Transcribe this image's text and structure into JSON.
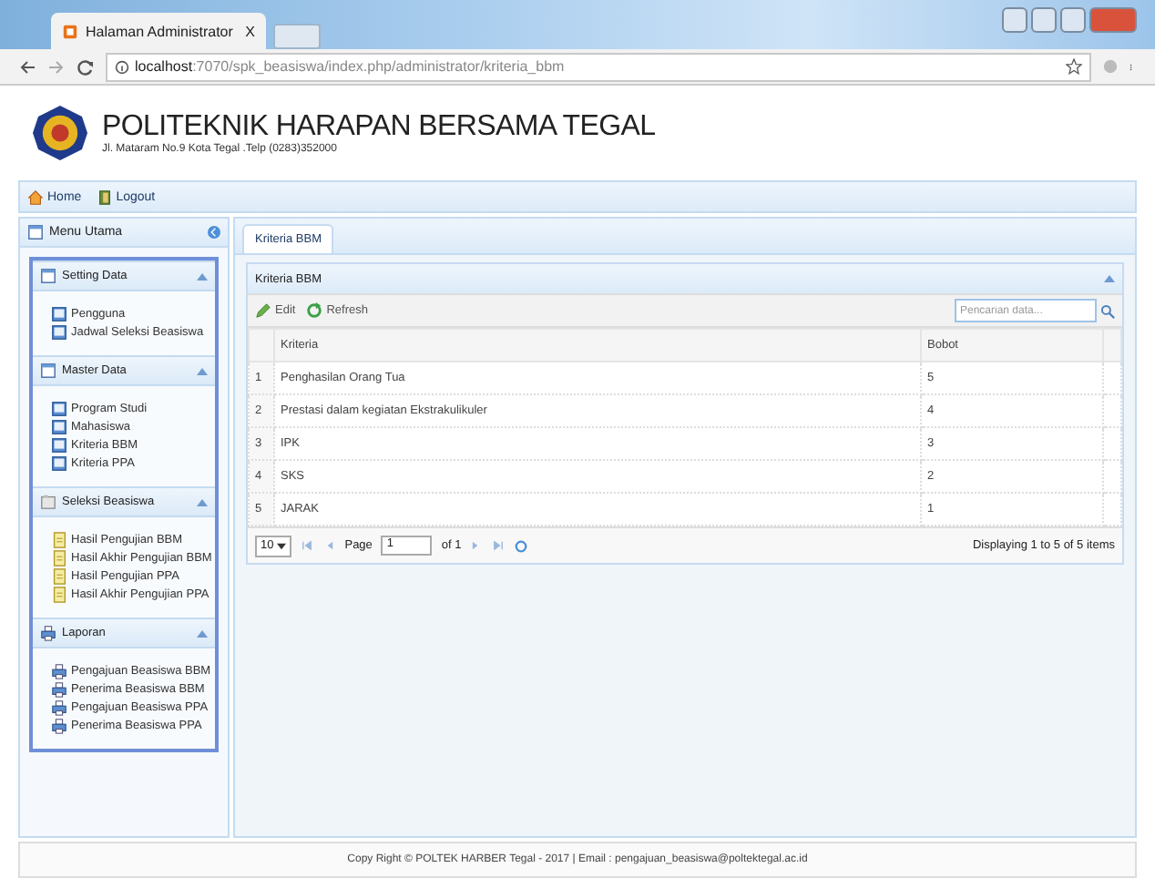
{
  "browser": {
    "tab_title": "Halaman Administrator",
    "tab_close": "X",
    "address_host": "localhost",
    "address_path": ":7070/spk_beasiswa/index.php/administrator/kriteria_bbm"
  },
  "header": {
    "title": "POLITEKNIK HARAPAN BERSAMA TEGAL",
    "subtitle": "Jl. Mataram No.9 Kota Tegal .Telp (0283)352000"
  },
  "nav": [
    {
      "label": "Home",
      "kind": "home"
    },
    {
      "label": "Logout",
      "kind": "logout"
    }
  ],
  "sidebar": {
    "title": "Menu Utama",
    "sections": [
      {
        "title": "Setting Data",
        "kind": "form",
        "expanded": true,
        "items": [
          {
            "label": "Pengguna",
            "kind": "book"
          },
          {
            "label": "Jadwal Seleksi Beasiswa",
            "kind": "book"
          }
        ]
      },
      {
        "title": "Master Data",
        "kind": "form",
        "expanded": true,
        "items": [
          {
            "label": "Program Studi",
            "kind": "book"
          },
          {
            "label": "Mahasiswa",
            "kind": "book"
          },
          {
            "label": "Kriteria BBM",
            "kind": "book"
          },
          {
            "label": "Kriteria PPA",
            "kind": "book"
          }
        ]
      },
      {
        "title": "Seleksi Beasiswa",
        "kind": "folder",
        "expanded": true,
        "items": [
          {
            "label": "Hasil Pengujian BBM",
            "kind": "document"
          },
          {
            "label": "Hasil Akhir Pengujian BBM",
            "kind": "document"
          },
          {
            "label": "Hasil Pengujian PPA",
            "kind": "document"
          },
          {
            "label": "Hasil Akhir Pengujian PPA",
            "kind": "document"
          }
        ]
      },
      {
        "title": "Laporan",
        "kind": "printer",
        "expanded": true,
        "items": [
          {
            "label": "Pengajuan Beasiswa BBM",
            "kind": "printer"
          },
          {
            "label": "Penerima Beasiswa BBM",
            "kind": "printer"
          },
          {
            "label": "Pengajuan Beasiswa PPA",
            "kind": "printer"
          },
          {
            "label": "Penerima Beasiswa PPA",
            "kind": "printer"
          }
        ]
      }
    ]
  },
  "tabs": [
    {
      "label": "Kriteria BBM",
      "selected": true
    }
  ],
  "panel": {
    "title": "Kriteria BBM",
    "actions": [
      {
        "label": "Edit",
        "kind": "edit"
      },
      {
        "label": "Refresh",
        "kind": "refresh"
      }
    ],
    "search": {
      "placeholder": "Pencarian data..."
    },
    "table": {
      "columns": [
        "Kriteria",
        "Bobot"
      ],
      "rows": [
        {
          "number": "1",
          "kriteria": "Penghasilan Orang Tua",
          "bobot": "5"
        },
        {
          "number": "2",
          "kriteria": "Prestasi dalam kegiatan Ekstrakulikuler",
          "bobot": "4"
        },
        {
          "number": "3",
          "kriteria": "IPK",
          "bobot": "3"
        },
        {
          "number": "4",
          "kriteria": "SKS",
          "bobot": "2"
        },
        {
          "number": "5",
          "kriteria": "JARAK",
          "bobot": "1"
        }
      ]
    },
    "pager": {
      "page_size": "10",
      "page_label": "Page",
      "page_value": "1",
      "of_label": "of 1",
      "summary": "Displaying 1 to 5 of 5 items"
    }
  },
  "footer": "Copy Right © POLTEK HARBER Tegal - 2017 | Email : pengajuan_beasiswa@poltektegal.ac.id"
}
